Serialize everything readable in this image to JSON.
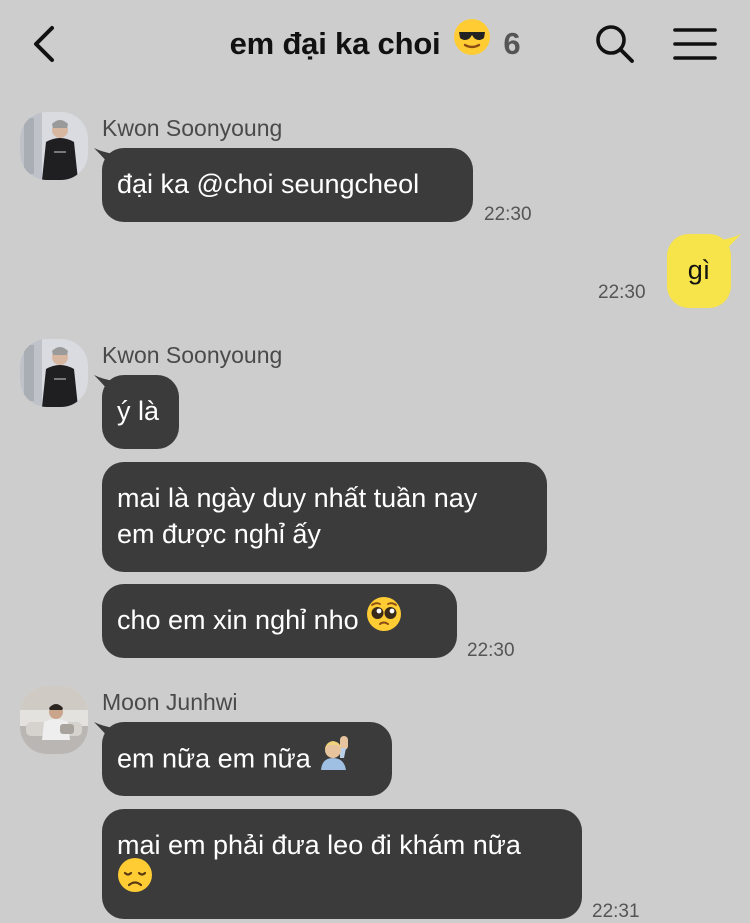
{
  "header": {
    "title": "em đại ka choi",
    "title_emoji": "sunglasses-face",
    "member_count": "6"
  },
  "messages": [
    {
      "sender": "Kwon Soonyoung",
      "lines": [
        "đại ka @choi seungcheol"
      ],
      "time": "22:30"
    },
    {
      "sender": "me",
      "lines": [
        "gì"
      ],
      "time": "22:30"
    },
    {
      "sender": "Kwon Soonyoung",
      "lines": [
        "ý là"
      ],
      "time": ""
    },
    {
      "sender": "Kwon Soonyoung",
      "lines": [
        "mai là ngày duy nhất tuần nay",
        "em được nghỉ ấy"
      ],
      "time": ""
    },
    {
      "sender": "Kwon Soonyoung",
      "lines": [
        "cho em xin nghỉ nho"
      ],
      "emoji": "pleading-face",
      "time": "22:30"
    },
    {
      "sender": "Moon Junhwi",
      "lines": [
        "em nữa em nữa"
      ],
      "emoji": "person-raising-hand",
      "time": ""
    },
    {
      "sender": "Moon Junhwi",
      "lines": [
        "mai em phải đưa leo đi khám nữa"
      ],
      "emoji": "disappointed-face",
      "time": "22:31"
    }
  ],
  "colors": {
    "background": "#cdcdcd",
    "incoming_bubble": "#3b3b3b",
    "outgoing_bubble": "#f7e34a",
    "timestamp": "#555555"
  }
}
